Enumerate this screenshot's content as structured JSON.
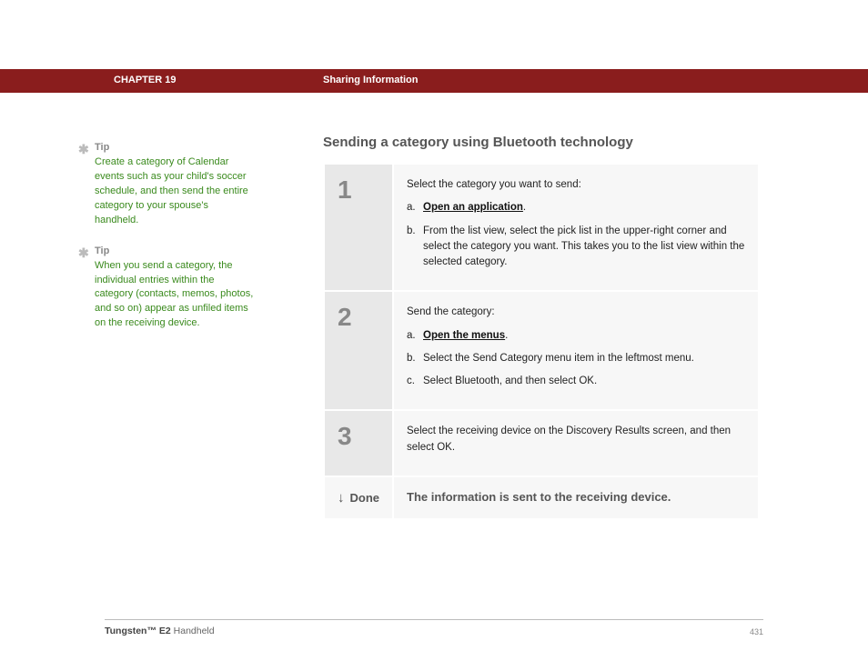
{
  "header": {
    "chapter": "CHAPTER 19",
    "title": "Sharing Information"
  },
  "sidebar": {
    "tips": [
      {
        "label": "Tip",
        "body": "Create a category of Calendar events such as your child's soccer schedule, and then send the entire category to your spouse's handheld."
      },
      {
        "label": "Tip",
        "body": "When you send a category, the individual entries within the category (contacts, memos, photos, and so on) appear as unfiled items on the receiving device."
      }
    ]
  },
  "main": {
    "section_title": "Sending a category using Bluetooth technology",
    "steps": [
      {
        "num": "1",
        "intro": "Select the category you want to send:",
        "items": [
          {
            "m": "a.",
            "link": "Open an application",
            "after": "."
          },
          {
            "m": "b.",
            "text": "From the list view, select the pick list in the upper-right corner and select the category you want. This takes you to the list view within the selected category."
          }
        ]
      },
      {
        "num": "2",
        "intro": "Send the category:",
        "items": [
          {
            "m": "a.",
            "link": "Open the menus",
            "after": "."
          },
          {
            "m": "b.",
            "text": "Select the Send Category menu item in the leftmost menu."
          },
          {
            "m": "c.",
            "text": "Select Bluetooth, and then select OK."
          }
        ]
      },
      {
        "num": "3",
        "intro": "Select the receiving device on the Discovery Results screen, and then select OK."
      }
    ],
    "done": {
      "label": "Done",
      "text": "The information is sent to the receiving device."
    }
  },
  "footer": {
    "product_bold": "Tungsten™ E2",
    "product_rest": " Handheld",
    "page": "431"
  }
}
